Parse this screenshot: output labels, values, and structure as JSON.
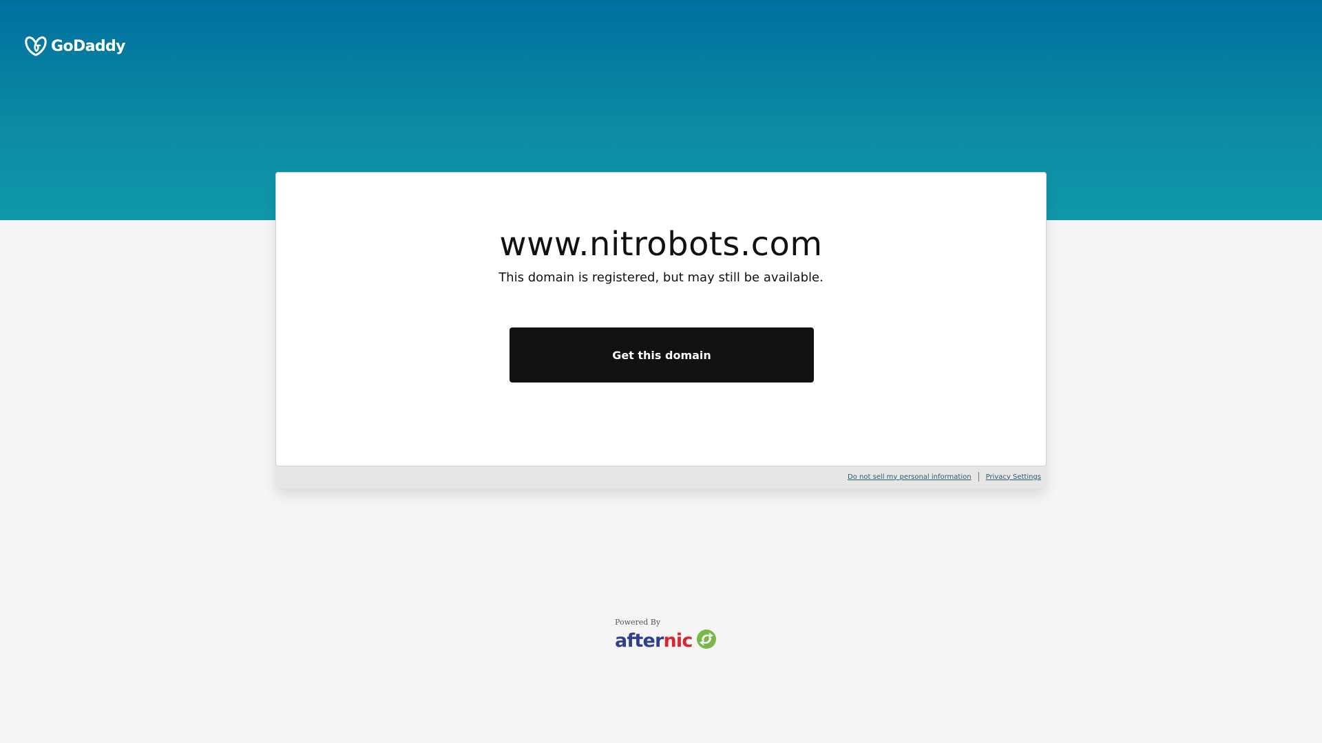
{
  "brand": {
    "name": "GoDaddy",
    "logo_icon": "godaddy-heart-icon"
  },
  "domain": {
    "name": "www.nitrobots.com",
    "status": "This domain is registered, but may still be available."
  },
  "cta": {
    "label": "Get this domain"
  },
  "legal": {
    "do_not_sell": "Do not sell my personal information",
    "privacy": "Privacy Settings"
  },
  "footer": {
    "powered_by": "Powered By",
    "partner_part1": "after",
    "partner_part2": "nic",
    "partner_icon": "afternic-arrows-icon"
  },
  "colors": {
    "hero_top": "#006f9e",
    "hero_bottom": "#1098aa",
    "cta_bg": "#111111",
    "afternic_blue": "#2f3f8f",
    "afternic_red": "#d8262f",
    "afternic_green": "#7ab648"
  }
}
